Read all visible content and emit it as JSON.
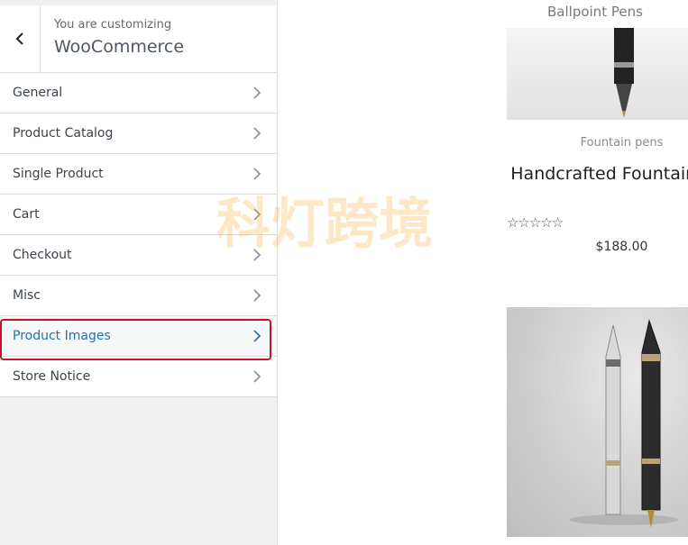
{
  "header": {
    "subtitle": "You are customizing",
    "title": "WooCommerce"
  },
  "menu": [
    {
      "label": "General"
    },
    {
      "label": "Product Catalog"
    },
    {
      "label": "Single Product"
    },
    {
      "label": "Cart"
    },
    {
      "label": "Checkout"
    },
    {
      "label": "Misc"
    },
    {
      "label": "Product Images"
    },
    {
      "label": "Store Notice"
    }
  ],
  "preview": {
    "top_category": "Ballpoint Pens",
    "product": {
      "category": "Fountain pens",
      "title": "Handcrafted Fountain Pen",
      "stars": "☆☆☆☆☆",
      "price": "$188.00"
    }
  },
  "watermark": {
    "text": "科灯跨境"
  },
  "colors": {
    "highlight": "#c8102e",
    "active_text": "#2271b1"
  }
}
